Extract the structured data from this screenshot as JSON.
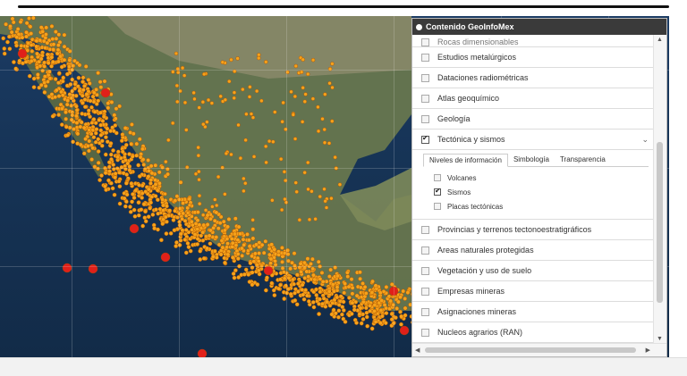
{
  "panel": {
    "title": "Contenido GeoInfoMex",
    "items_top": [
      {
        "label": "Rocas dimensionables",
        "partial": true
      },
      {
        "label": "Estudios metalúrgicos"
      },
      {
        "label": "Dataciones radiométricas"
      },
      {
        "label": "Atlas geoquímico"
      },
      {
        "label": "Geología"
      }
    ],
    "expanded": {
      "label": "Tectónica y sismos",
      "tabs": [
        "Niveles de información",
        "Simbología",
        "Transparencia"
      ],
      "options": [
        {
          "label": "Volcanes",
          "checked": false
        },
        {
          "label": "Sismos",
          "checked": true
        },
        {
          "label": "Placas tectónicas",
          "checked": false
        }
      ]
    },
    "items_bottom": [
      {
        "label": "Provincias y terrenos tectonoestratigráficos"
      },
      {
        "label": "Areas naturales protegidas"
      },
      {
        "label": "Vegetación y uso de suelo"
      },
      {
        "label": "Empresas mineras"
      },
      {
        "label": "Asignaciones mineras"
      },
      {
        "label": "Nucleos agrarios (RAN)"
      }
    ]
  },
  "colors": {
    "ocean": "#163355",
    "land": "#6b7a4e",
    "quake_small": "#f6a21a",
    "quake_large": "#e0201a"
  }
}
